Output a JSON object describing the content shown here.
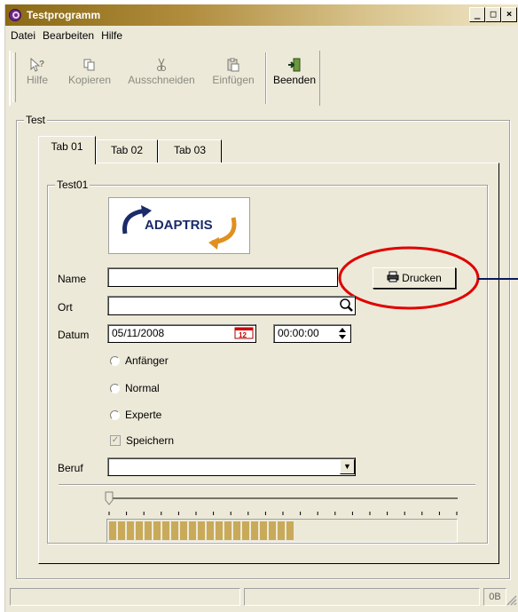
{
  "window": {
    "title": "Testprogramm",
    "min": "_",
    "max": "□",
    "close": "×"
  },
  "menu": [
    {
      "label": "Datei",
      "accel": "D"
    },
    {
      "label": "Bearbeiten",
      "accel": "B"
    },
    {
      "label": "Hilfe",
      "accel": "H"
    }
  ],
  "toolbar": {
    "hilfe": "Hilfe",
    "kopieren": "Kopieren",
    "ausschneiden": "Ausschneiden",
    "einfuegen": "Einfügen",
    "beenden": "Beenden"
  },
  "group_test": "Test",
  "tabs": [
    "Tab 01",
    "Tab 02",
    "Tab 03"
  ],
  "group_test01": "Test01",
  "logo_text": "ADAPTRIS",
  "form": {
    "name_label": "Name",
    "name_value": "",
    "ort_label": "Ort",
    "ort_value": "",
    "datum_label": "Datum",
    "datum_value": "05/11/2008",
    "time_value": "00:00:00",
    "print_label": "Drucken",
    "radios": [
      "Anfänger",
      "Normal",
      "Experte"
    ],
    "checkbox": "Speichern",
    "beruf_label": "Beruf",
    "beruf_value": ""
  },
  "slider": {
    "value": 0,
    "min": 0,
    "max": 100,
    "ticks": 20
  },
  "progress": {
    "percent": 55
  },
  "status": {
    "indicator": "0B"
  },
  "accent_color": "#e00000",
  "progress_color": "#c8aa5a"
}
